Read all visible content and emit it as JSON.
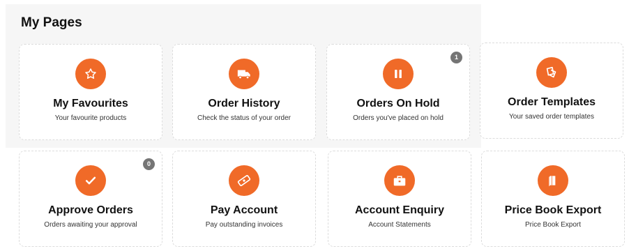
{
  "page": {
    "title": "My Pages"
  },
  "colors": {
    "accent": "#f06a28",
    "badge": "#757575"
  },
  "cards": [
    {
      "title": "My Favourites",
      "subtitle": "Your favourite products",
      "icon": "star-icon"
    },
    {
      "title": "Order History",
      "subtitle": "Check the status of your order",
      "icon": "truck-icon"
    },
    {
      "title": "Orders On Hold",
      "subtitle": "Orders you've placed on hold",
      "icon": "pause-icon",
      "badge": "1"
    },
    {
      "title": "Order Templates",
      "subtitle": "Your saved order templates",
      "icon": "templates-icon"
    },
    {
      "title": "Approve Orders",
      "subtitle": "Orders awaiting your approval",
      "icon": "checkmark-icon",
      "badge": "0"
    },
    {
      "title": "Pay Account",
      "subtitle": "Pay outstanding invoices",
      "icon": "ticket-icon"
    },
    {
      "title": "Account Enquiry",
      "subtitle": "Account Statements",
      "icon": "briefcase-icon"
    },
    {
      "title": "Price Book Export",
      "subtitle": "Price Book Export",
      "icon": "book-icon"
    }
  ]
}
